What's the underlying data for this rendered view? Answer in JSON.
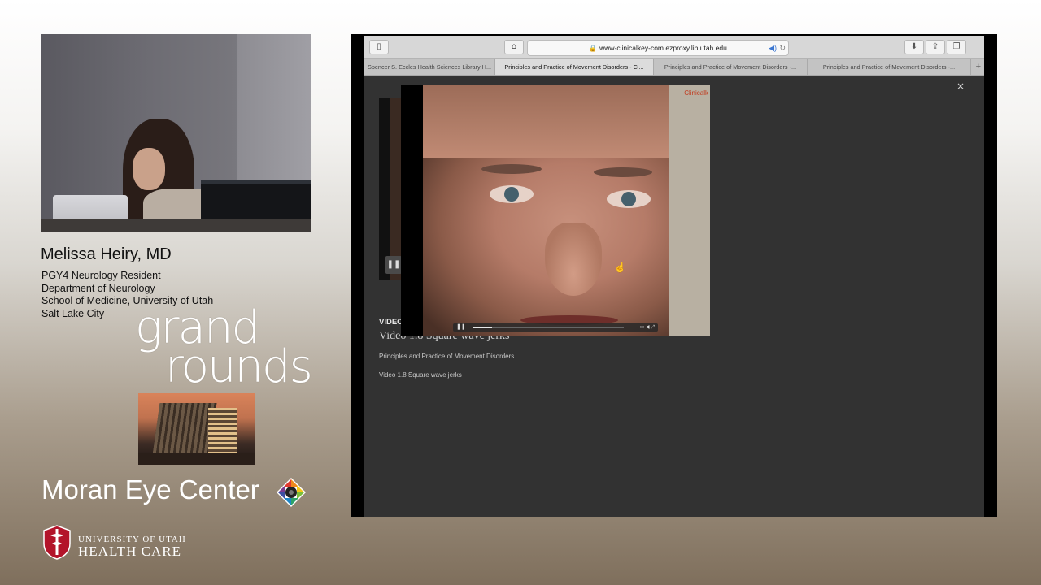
{
  "speaker": {
    "name": "Melissa Heiry, MD",
    "lines": [
      "PGY4 Neurology Resident",
      "Department of Neurology",
      "School of Medicine, University of Utah",
      "Salt Lake City"
    ]
  },
  "branding": {
    "grand": "grand",
    "rounds": "rounds",
    "moran": "Moran Eye Center",
    "uhc_line1": "UNIVERSITY OF UTAH",
    "uhc_line2": "HEALTH CARE"
  },
  "browser": {
    "url": "www-clinicalkey-com.ezproxy.lib.utah.edu",
    "tabs": [
      "Spencer S. Eccles Health Sciences Library H...",
      "Principles and Practice of Movement Disorders - Cl...",
      "Principles and Practice of Movement Disorders -...",
      "Principles and Practice of Movement Disorders -..."
    ],
    "active_tab": 1
  },
  "page": {
    "close": "×",
    "video_label": "VIDEO",
    "video_title": "Video 1.8 Square wave jerks",
    "subtitle": "Principles and Practice of Movement Disorders.",
    "caption": "Video 1.8 Square wave jerks",
    "watermark": "Clinicalk",
    "progress_fraction": 0.13
  },
  "icons": {
    "sidebar": "sidebar-icon",
    "home": "home-icon",
    "download": "download-icon",
    "share": "share-icon",
    "tabs": "tabs-overview-icon",
    "lock": "lock-icon",
    "audio": "speaker-icon",
    "reload": "reload-icon"
  }
}
